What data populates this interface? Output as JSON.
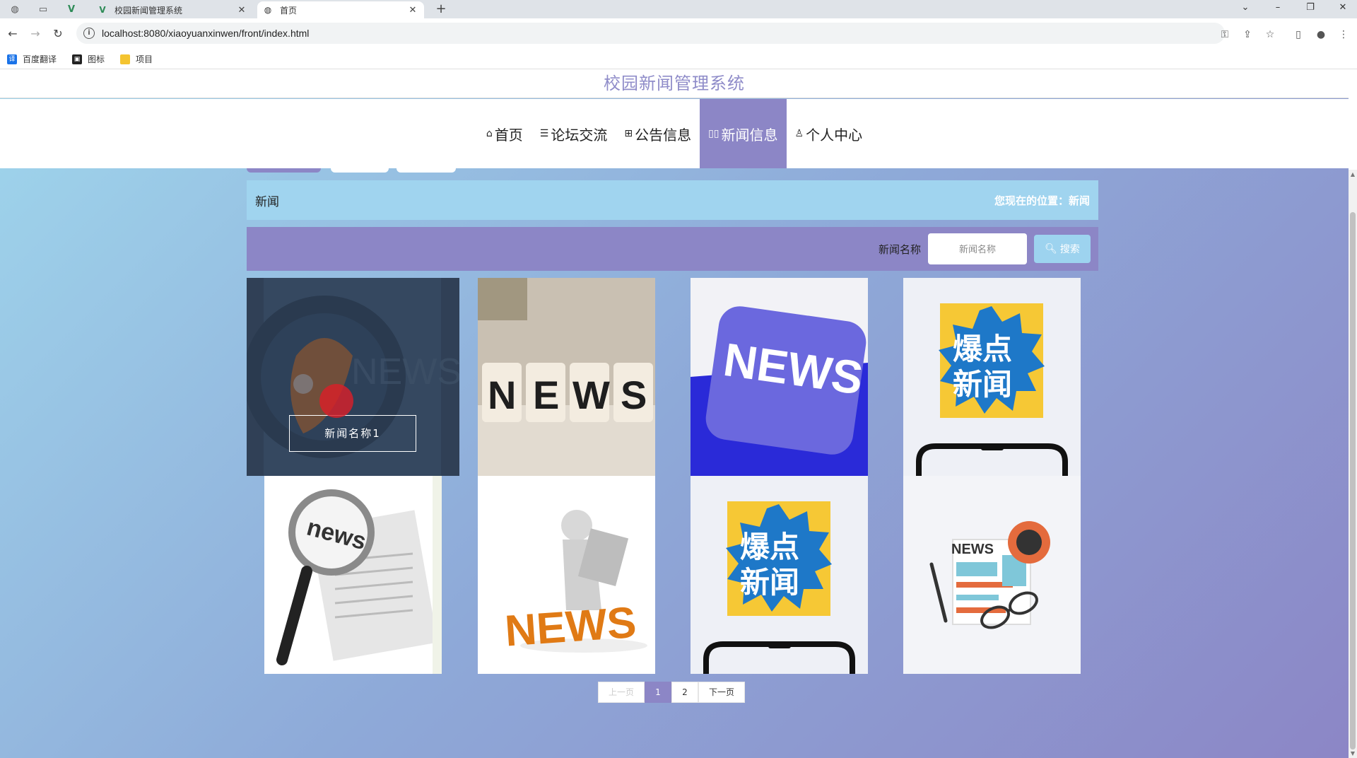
{
  "browser": {
    "tabs": [
      {
        "title": "校园新闻管理系统",
        "active": false
      },
      {
        "title": "首页",
        "active": true
      }
    ],
    "url": "localhost:8080/xiaoyuanxinwen/front/index.html",
    "bookmarks": [
      {
        "label": "百度翻译",
        "icon": "translate-icon",
        "color": "#1a73e8"
      },
      {
        "label": "图标",
        "icon": "image-icon",
        "color": "#222222"
      },
      {
        "label": "项目",
        "icon": "folder-icon",
        "color": "#f4c430"
      }
    ]
  },
  "site": {
    "title": "校园新闻管理系统",
    "accent": "#8c86c6",
    "light_accent": "#a0d4ef"
  },
  "nav": {
    "items": [
      {
        "label": "首页",
        "icon": "home-icon",
        "active": false
      },
      {
        "label": "论坛交流",
        "icon": "layers-icon",
        "active": false
      },
      {
        "label": "公告信息",
        "icon": "grid-icon",
        "active": false
      },
      {
        "label": "新闻信息",
        "icon": "news-icon",
        "active": true
      },
      {
        "label": "个人中心",
        "icon": "user-icon",
        "active": false
      }
    ]
  },
  "breadcrumb": {
    "title": "新闻",
    "position": "您现在的位置：新闻"
  },
  "search": {
    "label": "新闻名称",
    "placeholder": "新闻名称",
    "button": "搜索"
  },
  "news": {
    "hover_label": "新闻名称1",
    "cards": [
      {
        "image": "globe-news-image"
      },
      {
        "image": "news-cubes-image"
      },
      {
        "image": "news-key-image"
      },
      {
        "image": "breaking-news-phone-image",
        "text": [
          "爆点",
          "新闻"
        ]
      },
      {
        "image": "magnifier-newspaper-image",
        "text": [
          "news"
        ]
      },
      {
        "image": "person-reading-news-image",
        "text": [
          "NEWS"
        ]
      },
      {
        "image": "breaking-news-phone-image",
        "text": [
          "爆点",
          "新闻"
        ]
      },
      {
        "image": "news-illustration-image",
        "text": [
          "NEWS"
        ]
      }
    ]
  },
  "pagination": {
    "prev": "上一页",
    "pages": [
      "1",
      "2"
    ],
    "current": "1",
    "next": "下一页"
  }
}
